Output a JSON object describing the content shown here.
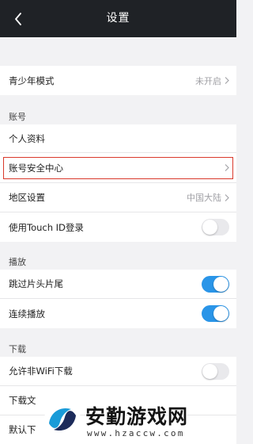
{
  "header": {
    "title": "设置",
    "back_icon": "chevron-left-icon"
  },
  "rows": {
    "teen_mode": {
      "label": "青少年模式",
      "value": "未开启"
    },
    "personal_info": {
      "label": "个人资料"
    },
    "account_security": {
      "label": "账号安全中心"
    },
    "region": {
      "label": "地区设置",
      "value": "中国大陆"
    },
    "touch_id": {
      "label": "使用Touch ID登录",
      "enabled": false
    },
    "skip_intro": {
      "label": "跳过片头片尾",
      "enabled": true
    },
    "continuous_play": {
      "label": "连续播放",
      "enabled": true
    },
    "non_wifi_download": {
      "label": "允许非WiFi下载",
      "enabled": false
    },
    "download_file": {
      "label": "下载文"
    },
    "default_download": {
      "label": "默认下"
    }
  },
  "sections": {
    "account": "账号",
    "playback": "播放",
    "download": "下载"
  },
  "watermark": {
    "name": "安勤游戏网",
    "url": "www.hzaccw.com"
  },
  "colors": {
    "header_bg": "#1f2226",
    "toggle_on": "#2a95e8",
    "highlight": "#d9392b"
  }
}
